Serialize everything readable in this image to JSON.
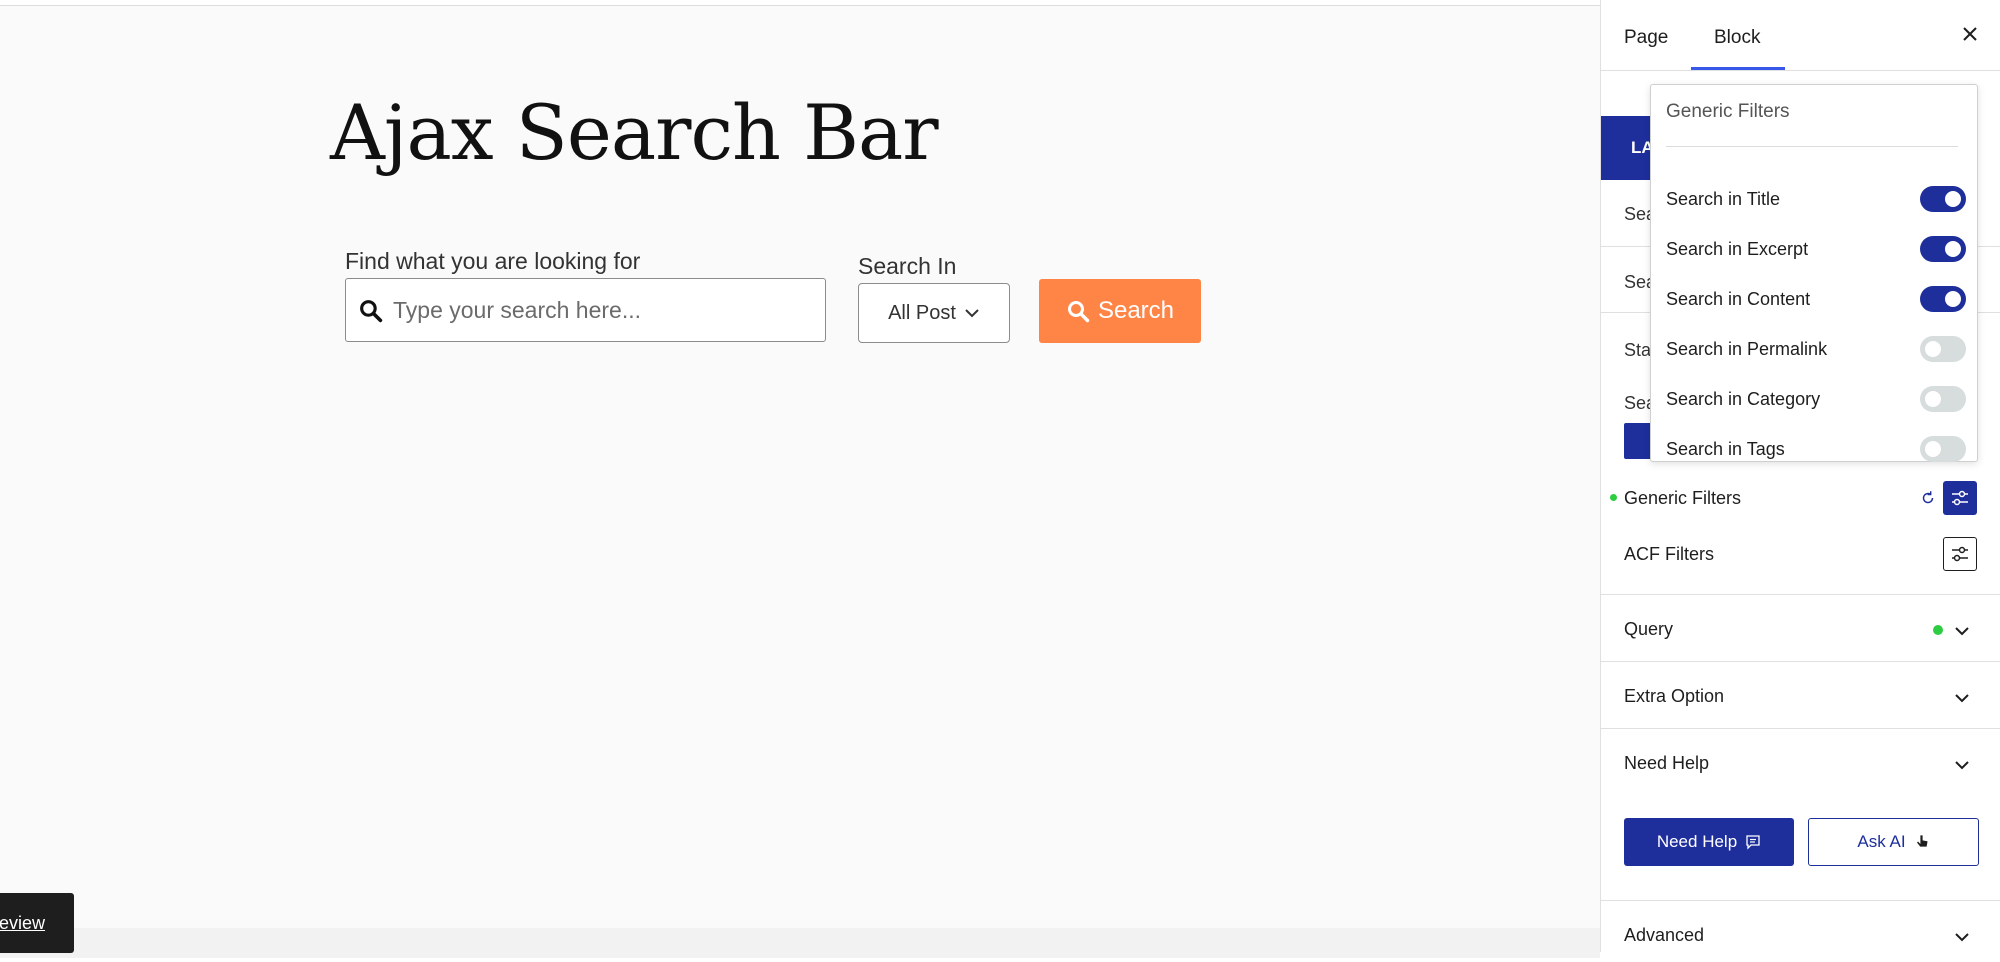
{
  "editor": {
    "title": "Ajax Search Bar",
    "search_label": "Find what you are looking for",
    "search_placeholder": "Type your search here...",
    "search_in_label": "Search In",
    "post_type_selected": "All Post",
    "search_button": "Search",
    "preview_button": "eview"
  },
  "sidebar": {
    "tabs": [
      "Page",
      "Block"
    ],
    "active_tab": "Block",
    "layout_tab_fragment": "LA",
    "hidden_row_fragments": [
      "Sea",
      "Sea",
      "Sta",
      "Sea"
    ],
    "generic_filters_label": "Generic Filters",
    "acf_filters_label": "ACF Filters",
    "panels": [
      {
        "title": "Query",
        "modified": true
      },
      {
        "title": "Extra Option",
        "modified": false
      },
      {
        "title": "Need Help",
        "modified": false
      }
    ],
    "help_buttons": {
      "need_help": "Need Help",
      "ask_ai": "Ask AI"
    },
    "advanced_panel": "Advanced"
  },
  "popover": {
    "title": "Generic Filters",
    "toggles": [
      {
        "label": "Search in Title",
        "enabled": true
      },
      {
        "label": "Search in Excerpt",
        "enabled": true
      },
      {
        "label": "Search in Content",
        "enabled": true
      },
      {
        "label": "Search in Permalink",
        "enabled": false
      },
      {
        "label": "Search in Category",
        "enabled": false
      },
      {
        "label": "Search in Tags",
        "enabled": false
      }
    ]
  },
  "colors": {
    "accent": "#1e2f9c",
    "search_button": "#ff8547",
    "modified_dot": "#2ecc40"
  },
  "icons": [
    "search-icon",
    "chevron-down-icon",
    "close-icon",
    "reset-icon",
    "filter-settings-icon",
    "chat-bubble-icon",
    "hand-cursor-icon"
  ]
}
